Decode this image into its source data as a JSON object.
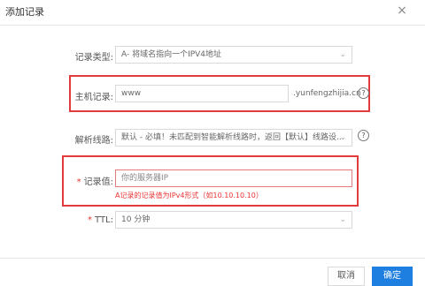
{
  "dialog": {
    "title": "添加记录",
    "close_glyph": "×"
  },
  "form": {
    "record_type": {
      "label": "记录类型:",
      "value": "A- 将域名指向一个IPV4地址"
    },
    "host": {
      "label": "主机记录:",
      "value": "www",
      "suffix": ".yunfengzhijia.cn"
    },
    "line": {
      "label": "解析线路:",
      "value": "默认 - 必填！未匹配到智能解析线路时，返回【默认】线路设..."
    },
    "record_value": {
      "required_mark": "*",
      "label": "记录值:",
      "placeholder": "你的服务器IP",
      "error": "A记录的记录值为IPv4形式（如10.10.10.10）"
    },
    "ttl": {
      "required_mark": "*",
      "label": "TTL:",
      "value": "10 分钟"
    }
  },
  "footer": {
    "cancel_label": "取消",
    "ok_label": "确定"
  },
  "icons": {
    "chevron": "⌄",
    "help": "?"
  },
  "colors": {
    "highlight": "#e33b3b",
    "primary": "#1e7fe0",
    "error": "#e33333"
  }
}
